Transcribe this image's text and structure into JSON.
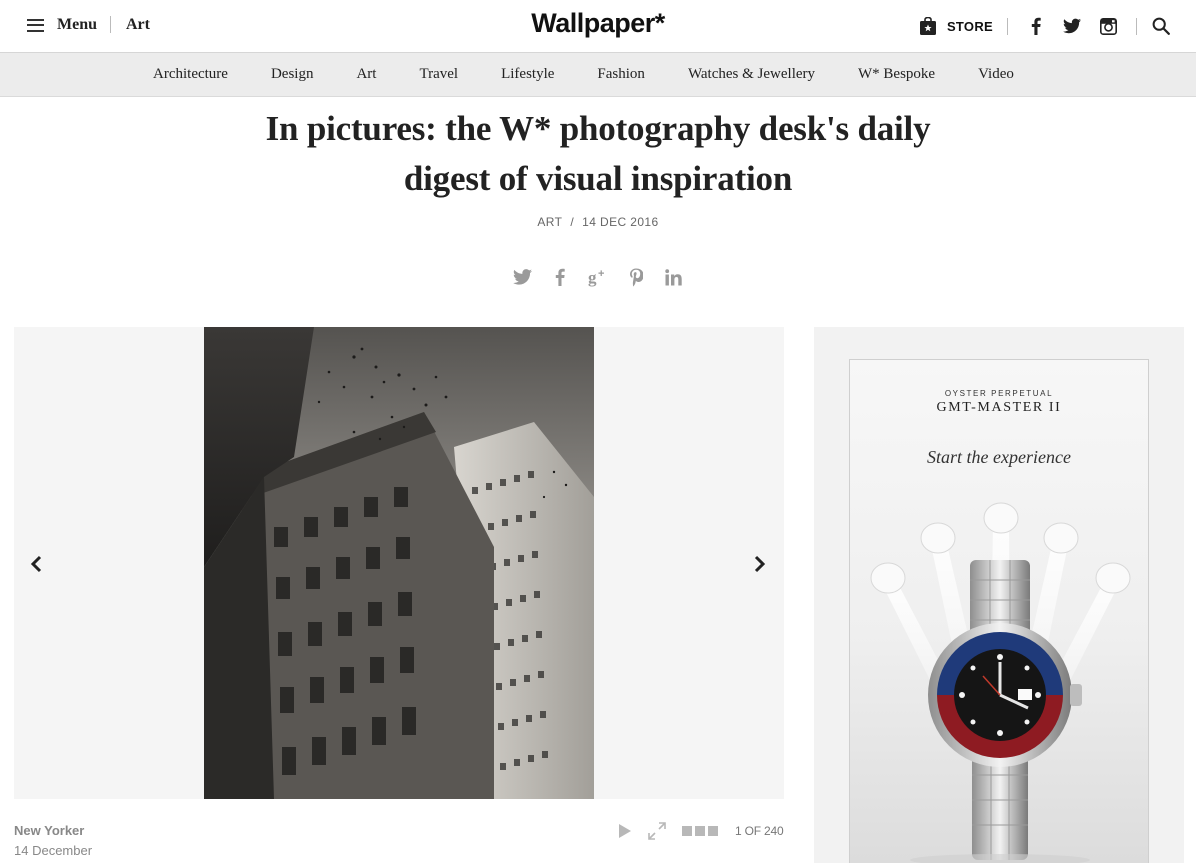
{
  "header": {
    "menu_label": "Menu",
    "section": "Art",
    "logo": "Wallpaper*",
    "store_label": "STORE",
    "social_icons": [
      "facebook-icon",
      "twitter-icon",
      "instagram-icon"
    ],
    "search_icon": "search-icon"
  },
  "nav": {
    "items": [
      "Architecture",
      "Design",
      "Art",
      "Travel",
      "Lifestyle",
      "Fashion",
      "Watches & Jewellery",
      "W* Bespoke",
      "Video"
    ]
  },
  "article": {
    "title_line1": "In pictures: the W* photography desk's daily",
    "title_line2": "digest of visual inspiration",
    "category": "ART",
    "separator": "/",
    "date": "14 DEC 2016",
    "share_icons": [
      "twitter-icon",
      "facebook-icon",
      "google-plus-icon",
      "pinterest-icon",
      "linkedin-icon"
    ]
  },
  "gallery": {
    "caption_title": "New Yorker",
    "caption_date": "14 December",
    "counter": "1 OF 240",
    "image_description": "black and white photograph of skyscrapers and birds"
  },
  "ad": {
    "brand_line": "OYSTER PERPETUAL",
    "model": "GMT-MASTER II",
    "tagline": "Start the experience"
  },
  "colors": {
    "nav_bg": "#ececec",
    "text": "#222222",
    "muted": "#888888",
    "icon_grey": "#9a9a9a"
  }
}
